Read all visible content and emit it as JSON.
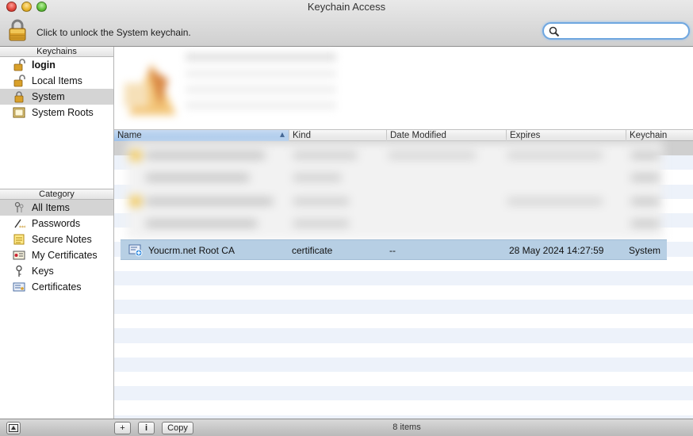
{
  "window": {
    "title": "Keychain Access"
  },
  "toolbar": {
    "lock_message": "Click to unlock the System keychain.",
    "search_value": ""
  },
  "sidebar": {
    "keychains_header": "Keychains",
    "keychains": [
      {
        "label": "login",
        "icon": "lock-open-icon"
      },
      {
        "label": "Local Items",
        "icon": "lock-open-icon"
      },
      {
        "label": "System",
        "icon": "lock-closed-icon"
      },
      {
        "label": "System Roots",
        "icon": "cabinet-icon"
      }
    ],
    "category_header": "Category",
    "categories": [
      {
        "label": "All Items",
        "icon": "all-items-icon"
      },
      {
        "label": "Passwords",
        "icon": "password-icon"
      },
      {
        "label": "Secure Notes",
        "icon": "secure-note-icon"
      },
      {
        "label": "My Certificates",
        "icon": "my-certificate-icon"
      },
      {
        "label": "Keys",
        "icon": "key-icon"
      },
      {
        "label": "Certificates",
        "icon": "certificate-icon"
      }
    ]
  },
  "table": {
    "columns": [
      "Name",
      "Kind",
      "Date Modified",
      "Expires",
      "Keychain"
    ],
    "selected_row": {
      "name": "Youcrm.net Root CA",
      "kind": "certificate",
      "date_modified": "--",
      "expires": "28 May 2024 14:27:59",
      "keychain": "System"
    }
  },
  "status": {
    "item_count": "8 items"
  },
  "bottom_buttons": {
    "add": "+",
    "info": "i",
    "copy": "Copy"
  },
  "colors": {
    "selection": "#b7cfe4",
    "stripe": "#edf2fa",
    "search_focus": "#6fa7e0"
  }
}
